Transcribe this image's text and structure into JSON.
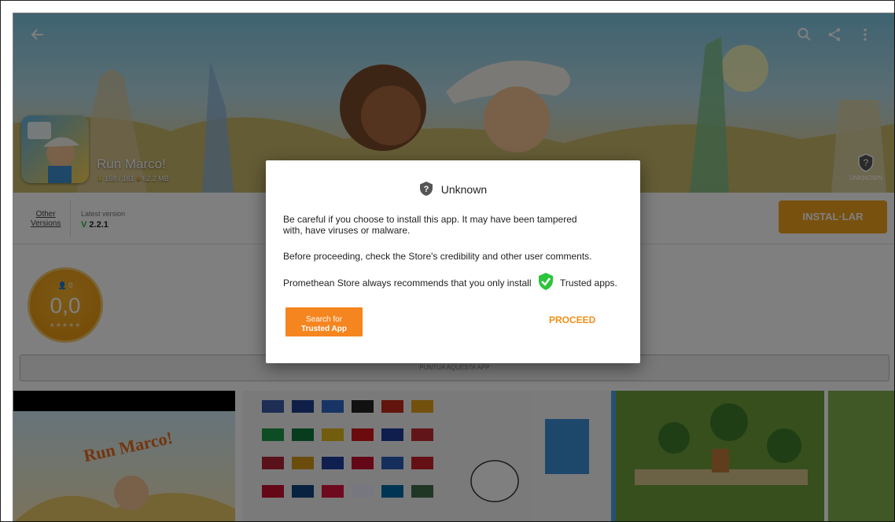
{
  "app": {
    "name": "Run Marco!",
    "downloads": "158",
    "separator": "/",
    "downloads_total": "161",
    "size": "62.2 MB",
    "security_badge": "UNKNOWN"
  },
  "toolbar": {
    "back_icon": "arrow-left-icon",
    "search_icon": "search-icon",
    "share_icon": "share-icon",
    "more_icon": "more-vertical-icon"
  },
  "info": {
    "other_versions_line1": "Other",
    "other_versions_line2": "Versions",
    "latest_label": "Latest version",
    "version_prefix": "V",
    "version": "2.2.1",
    "install_label": "INSTAL·LAR"
  },
  "rating": {
    "count": "0",
    "value": "0,0",
    "stars": "★★★★★",
    "rate_label": "PUNTUA AQUESTA APP"
  },
  "dialog": {
    "title": "Unknown",
    "paragraph1": "Be careful if you choose to install this app. It may have been tampered with, have viruses or malware.",
    "paragraph2": "Before proceeding, check the Store's credibility and other user comments.",
    "paragraph3_before": "Promethean Store always recommends that you only install",
    "paragraph3_after": "Trusted apps.",
    "search_line1": "Search for",
    "search_line2": "Trusted App",
    "proceed_label": "PROCEED"
  },
  "colors": {
    "accent_orange": "#f5851f",
    "install_orange": "#f0a21e",
    "trusted_green": "#2bc43a",
    "version_green": "#2bb34a"
  }
}
